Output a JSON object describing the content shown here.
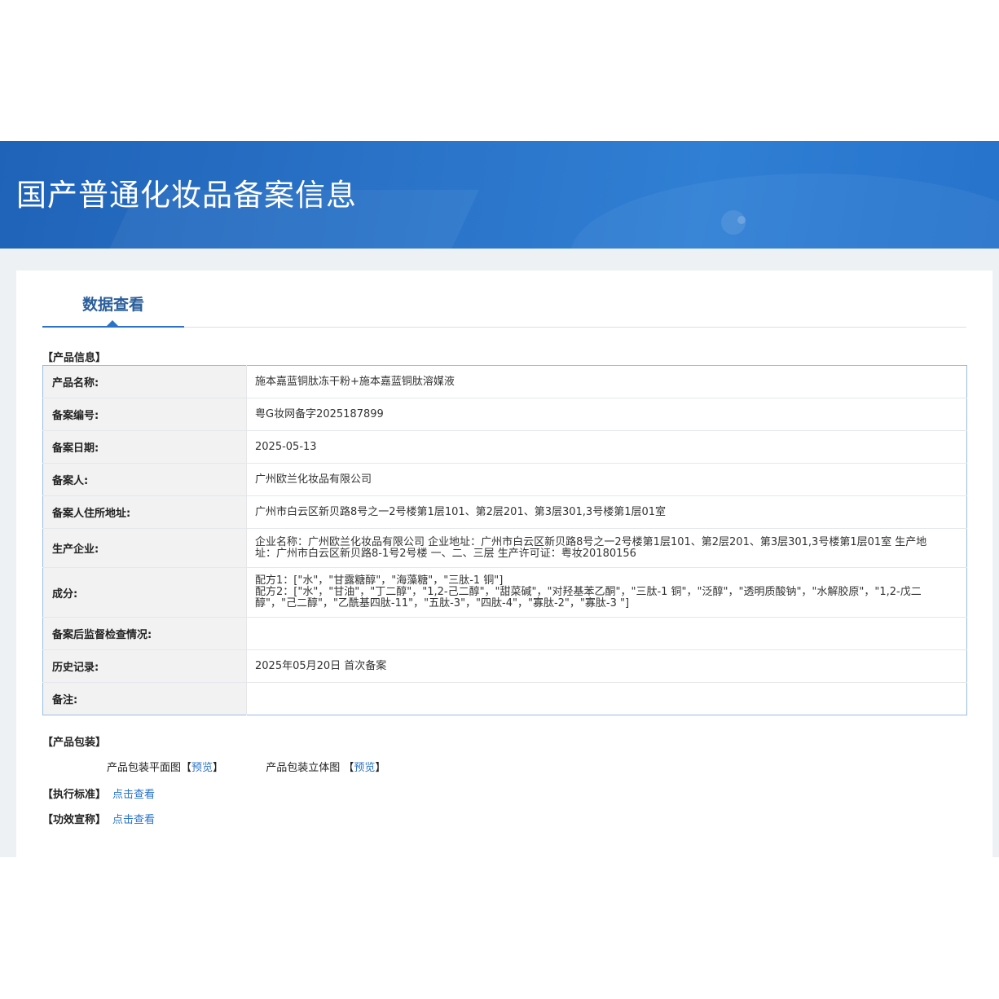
{
  "header": {
    "title": "国产普通化妆品备案信息"
  },
  "tab": {
    "label": "数据查看"
  },
  "product_info": {
    "section_title": "【产品信息】",
    "rows": [
      {
        "key": "产品名称:",
        "value": "施本嘉蓝铜肽冻干粉+施本嘉蓝铜肽溶媒液"
      },
      {
        "key": "备案编号:",
        "value": "粤G妆网备字2025187899"
      },
      {
        "key": "备案日期:",
        "value": "2025-05-13"
      },
      {
        "key": "备案人:",
        "value": "广州欧兰化妆品有限公司"
      },
      {
        "key": "备案人住所地址:",
        "value": "广州市白云区新贝路8号之一2号楼第1层101、第2层201、第3层301,3号楼第1层01室"
      },
      {
        "key": "生产企业:",
        "value": "企业名称：广州欧兰化妆品有限公司 企业地址：广州市白云区新贝路8号之一2号楼第1层101、第2层201、第3层301,3号楼第1层01室 生产地址：广州市白云区新贝路8-1号2号楼 一、二、三层 生产许可证：粤妆20180156"
      },
      {
        "key": "成分:",
        "value": "配方1：[\"水\"，\"甘露糖醇\"，\"海藻糖\"，\"三肽-1 铜\"]\n配方2：[\"水\"，\"甘油\"，\"丁二醇\"，\"1,2-己二醇\"，\"甜菜碱\"，\"对羟基苯乙酮\"，\"三肽-1 铜\"，\"泛醇\"，\"透明质酸钠\"，\"水解胶原\"，\"1,2-戊二醇\"，\"己二醇\"，\"乙酰基四肽-11\"，\"五肽-3\"，\"四肽-4\"，\"寡肽-2\"，\"寡肽-3 \"]"
      },
      {
        "key": "备案后监督检查情况:",
        "value": ""
      },
      {
        "key": "历史记录:",
        "value": "2025年05月20日 首次备案"
      },
      {
        "key": "备注:",
        "value": ""
      }
    ]
  },
  "packaging": {
    "section_title": "【产品包装】",
    "flat_label": "产品包装平面图",
    "three_d_label": "产品包装立体图",
    "bracket_open": "【",
    "bracket_close": "】",
    "preview_label": "预览"
  },
  "standard": {
    "section_title": "【执行标准】",
    "link_label": "点击查看"
  },
  "efficacy": {
    "section_title": "【功效宣称】",
    "link_label": "点击查看"
  },
  "colors": {
    "banner": "#2a73c8",
    "accent": "#2a73c8",
    "tab_text": "#2a5e9b",
    "page_bg": "#eef1f4"
  }
}
